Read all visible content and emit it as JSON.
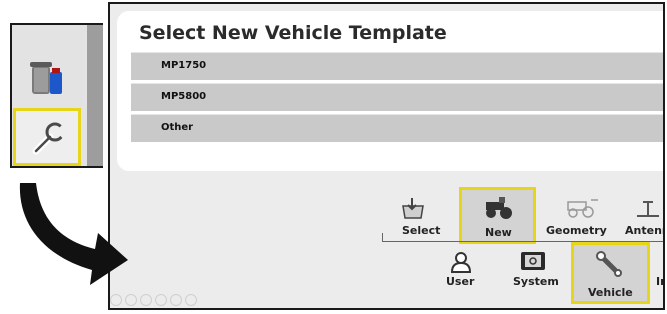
{
  "dialog": {
    "title": "Select New Vehicle Template",
    "templates": [
      {
        "label": "MP1750"
      },
      {
        "label": "MP5800"
      },
      {
        "label": "Other"
      }
    ]
  },
  "vehicle_tabs": {
    "select": "Select",
    "new": "New",
    "geometry": "Geometry",
    "antenna": "Antenn"
  },
  "setup_tabs": {
    "user": "User",
    "system": "System",
    "vehicle": "Vehicle",
    "cut": "In"
  },
  "colors": {
    "highlight": "#e7d51a",
    "row": "#c9c9c9"
  }
}
